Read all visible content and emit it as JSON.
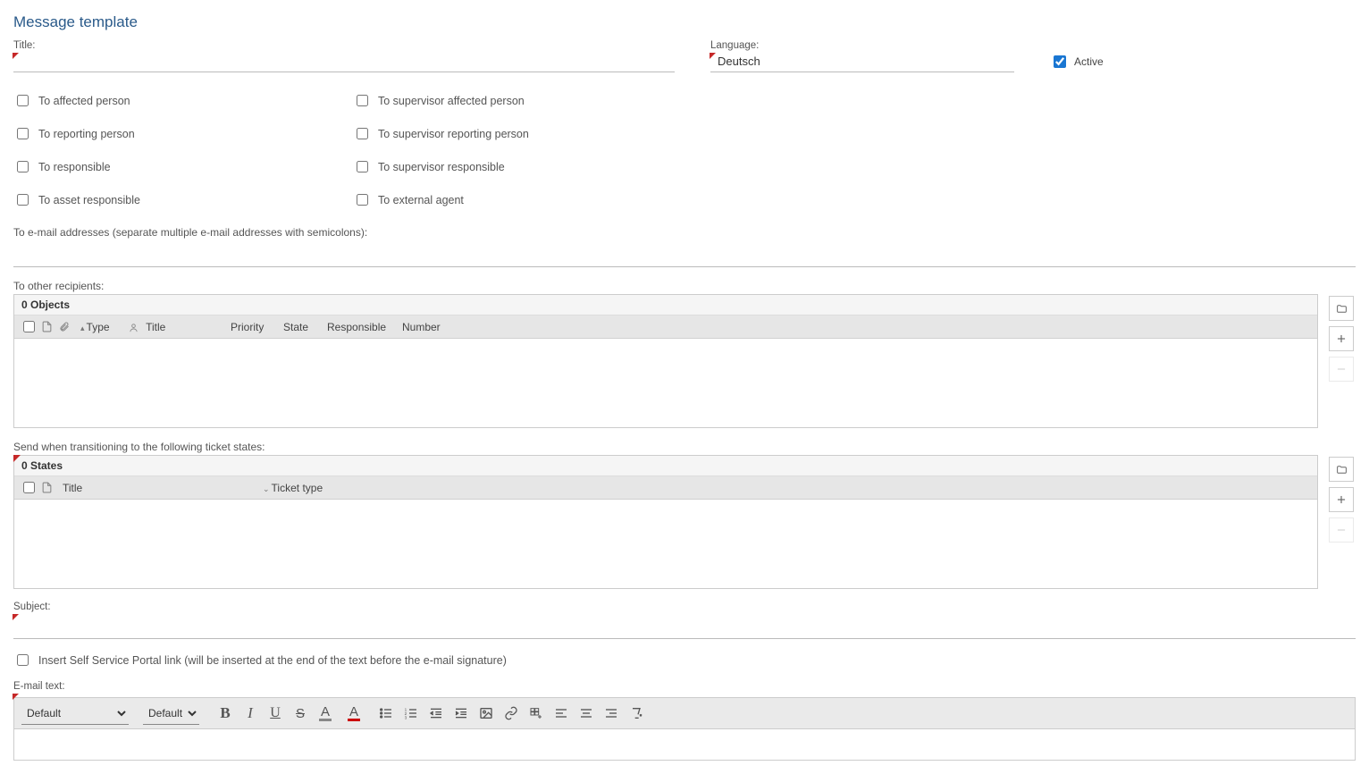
{
  "page": {
    "title": "Message template"
  },
  "fields": {
    "title_label": "Title:",
    "title_value": "",
    "language_label": "Language:",
    "language_value": "Deutsch",
    "active_label": "Active",
    "active_checked": true
  },
  "recipients": {
    "to_affected": "To affected person",
    "to_supervisor_affected": "To supervisor affected person",
    "to_reporting": "To reporting person",
    "to_supervisor_reporting": "To supervisor reporting person",
    "to_responsible": "To responsible",
    "to_supervisor_responsible": "To supervisor responsible",
    "to_asset_responsible": "To asset responsible",
    "to_external_agent": "To external agent"
  },
  "email_addr": {
    "label": "To e-mail addresses (separate multiple e-mail addresses with semicolons):",
    "value": ""
  },
  "other_recipients": {
    "label": "To other recipients:",
    "count_label": "0 Objects",
    "columns": {
      "type": "Type",
      "title": "Title",
      "priority": "Priority",
      "state": "State",
      "responsible": "Responsible",
      "number": "Number"
    }
  },
  "states": {
    "label": "Send when transitioning to the following ticket states:",
    "count_label": "0 States",
    "columns": {
      "title": "Title",
      "ticket_type": "Ticket type"
    }
  },
  "subject": {
    "label": "Subject:",
    "value": ""
  },
  "ssp": {
    "label": "Insert Self Service Portal link (will be inserted at the end of the text before the e-mail signature)"
  },
  "email_text": {
    "label": "E-mail text:"
  },
  "editor": {
    "font_family": "Default",
    "font_size": "Default"
  }
}
